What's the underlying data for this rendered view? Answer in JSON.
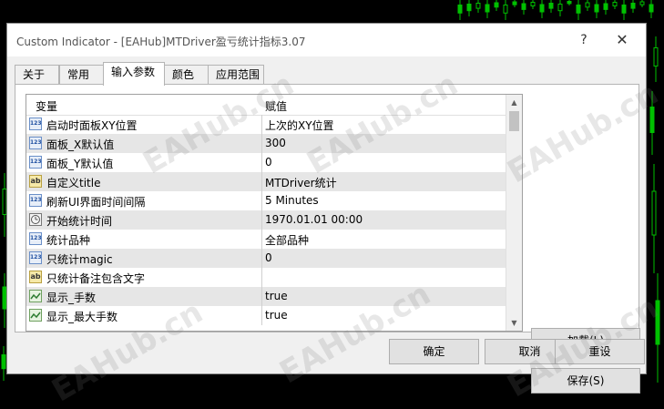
{
  "window": {
    "title": "Custom Indicator - [EAHub]MTDriver盈亏统计指标3.07",
    "help_symbol": "?",
    "close_symbol": "✕"
  },
  "tabs": [
    {
      "label": "关于"
    },
    {
      "label": "常用"
    },
    {
      "label": "输入参数",
      "active": true
    },
    {
      "label": "颜色"
    },
    {
      "label": "应用范围"
    }
  ],
  "grid": {
    "columns": [
      "变量",
      "赋值"
    ],
    "rows": [
      {
        "icon": "number-icon",
        "name": "启动时面板XY位置",
        "value": "上次的XY位置"
      },
      {
        "icon": "number-icon",
        "name": "面板_X默认值",
        "value": "300"
      },
      {
        "icon": "number-icon",
        "name": "面板_Y默认值",
        "value": "0"
      },
      {
        "icon": "text-icon",
        "name": "自定义title",
        "value": "MTDriver统计"
      },
      {
        "icon": "number-icon",
        "name": "刷新UI界面时间间隔",
        "value": "5 Minutes"
      },
      {
        "icon": "datetime-icon",
        "name": "开始统计时间",
        "value": "1970.01.01 00:00"
      },
      {
        "icon": "number-icon",
        "name": "统计品种",
        "value": "全部品种"
      },
      {
        "icon": "number-icon",
        "name": "只统计magic",
        "value": "0"
      },
      {
        "icon": "text-icon",
        "name": "只统计备注包含文字",
        "value": ""
      },
      {
        "icon": "boolean-icon",
        "name": "显示_手数",
        "value": "true"
      },
      {
        "icon": "boolean-icon",
        "name": "显示_最大手数",
        "value": "true"
      }
    ]
  },
  "buttons": {
    "load": "加载(L)",
    "save": "保存(S)",
    "ok": "确定",
    "cancel": "取消",
    "reset": "重设"
  },
  "watermark_text": "EAHub.cn",
  "colors": {
    "chart_background": "#000000",
    "chart_candles": "#00c000",
    "dialog_background": "#f0f0f0",
    "row_alt": "#e6e6e6"
  }
}
